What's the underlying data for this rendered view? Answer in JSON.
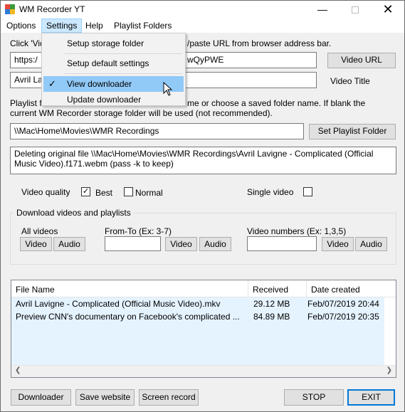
{
  "window": {
    "title": "WM Recorder YT"
  },
  "menu": {
    "items": [
      "Options",
      "Settings",
      "Help",
      "Playlist Folders"
    ]
  },
  "settings_menu": {
    "items": [
      {
        "label": "Setup storage folder",
        "checked": false
      },
      {
        "label": "Setup default settings",
        "checked": false
      },
      {
        "label": "View downloader",
        "checked": true,
        "highlighted": true
      },
      {
        "label": "Update downloader",
        "checked": false
      }
    ]
  },
  "url_section": {
    "instruction_left": "Click 'Vid",
    "instruction_right": "/paste URL from browser address bar.",
    "url_value_left": "https:/",
    "url_value_right": "wQyPWE",
    "video_url_button": "Video URL",
    "title_value": "Avril La",
    "video_title_label": "Video Title"
  },
  "playlist_section": {
    "instruction_left": "Playlist f",
    "instruction_right": "me or choose a saved folder name. If blank the",
    "instruction_line2": "current WM Recorder storage folder will be used (not recommended).",
    "folder_value": "\\\\Mac\\Home\\Movies\\WMR Recordings",
    "set_folder_button": "Set Playlist Folder"
  },
  "status": {
    "line1": "Deleting original file \\\\Mac\\Home\\Movies\\WMR Recordings\\Avril Lavigne - Complicated (Official",
    "line2": "Music Video).f171.webm (pass -k to keep)"
  },
  "options": {
    "video_quality_label": "Video quality",
    "best_label": "Best",
    "best_checked": true,
    "normal_label": "Normal",
    "normal_checked": false,
    "single_video_label": "Single video",
    "single_video_checked": false
  },
  "download_group": {
    "title": "Download videos and playlists",
    "all_videos_label": "All videos",
    "from_to_label": "From-To (Ex: 3-7)",
    "video_numbers_label": "Video numbers (Ex: 1,3,5)",
    "video_button": "Video",
    "audio_button": "Audio"
  },
  "file_list": {
    "columns": [
      "File Name",
      "Received",
      "Date created"
    ],
    "rows": [
      {
        "name": "Avril Lavigne - Complicated (Official Music Video).mkv",
        "received": "29.12 MB",
        "date": "Feb/07/2019 20:44"
      },
      {
        "name": "Preview CNN's documentary on Facebook's complicated ...",
        "received": "84.89 MB",
        "date": "Feb/07/2019 20:35"
      }
    ]
  },
  "footer": {
    "downloader_button": "Downloader",
    "save_website_button": "Save website",
    "screen_record_button": "Screen record",
    "stop_button": "STOP",
    "exit_button": "EXIT"
  },
  "colors": {
    "menu_highlight": "#91c9f7",
    "list_row": "#e5f3ff",
    "default_button_border": "#0078d7"
  }
}
